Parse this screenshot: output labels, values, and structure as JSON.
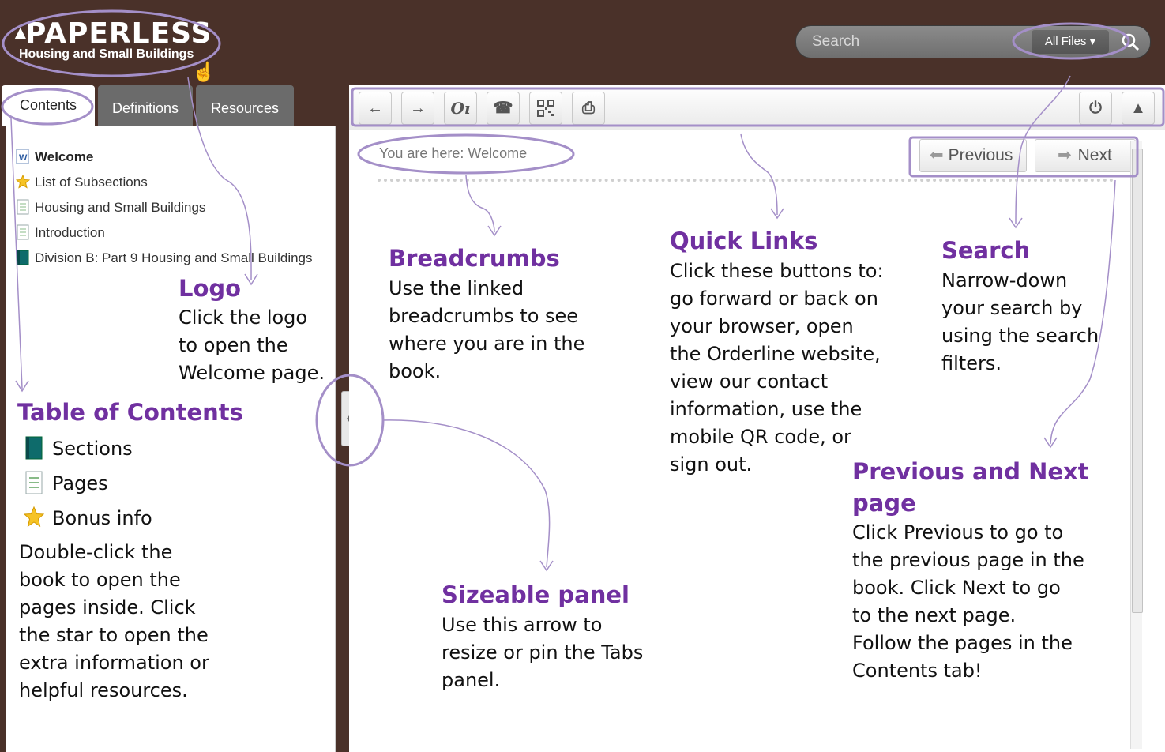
{
  "header": {
    "logo_text": "PAPERLESS",
    "logo_subtitle": "Housing and Small Buildings",
    "search_placeholder": "Search",
    "filter_label": "All Files ▾"
  },
  "tabs": [
    {
      "label": "Contents",
      "active": true
    },
    {
      "label": "Definitions",
      "active": false
    },
    {
      "label": "Resources",
      "active": false
    }
  ],
  "toc": [
    {
      "label": "Welcome",
      "icon": "word-doc-icon"
    },
    {
      "label": "List of Subsections",
      "icon": "star-icon"
    },
    {
      "label": "Housing and Small Buildings",
      "icon": "page-icon"
    },
    {
      "label": "Introduction",
      "icon": "page-icon"
    },
    {
      "label": "Division B: Part 9 Housing and Small Buildings",
      "icon": "book-icon"
    }
  ],
  "toolbar": {
    "buttons": [
      "back-arrow-icon",
      "forward-arrow-icon",
      "orderline-icon",
      "phone-icon",
      "qr-code-icon",
      "print-icon",
      "power-icon",
      "tree-icon"
    ]
  },
  "content": {
    "breadcrumb": "You are here: Welcome",
    "prev_label": "Previous",
    "next_label": "Next"
  },
  "annotations": {
    "logo": {
      "title": "Logo",
      "lines": [
        "Click the logo",
        "to open the",
        "Welcome page."
      ]
    },
    "toc": {
      "title": "Table of Contents",
      "legend": [
        {
          "label": "Sections",
          "icon": "book-icon"
        },
        {
          "label": "Pages",
          "icon": "page-icon"
        },
        {
          "label": "Bonus info",
          "icon": "star-icon"
        }
      ],
      "lines": [
        "Double-click the",
        "book to open the",
        "pages inside. Click",
        "the star to open the",
        "extra information or",
        "helpful resources."
      ]
    },
    "breadcrumbs": {
      "title": "Breadcrumbs",
      "lines": [
        "Use the linked",
        "breadcrumbs to see",
        "where you are in the",
        "book."
      ]
    },
    "quick_links": {
      "title": "Quick Links",
      "lines": [
        "Click these buttons to:",
        "go forward or back on",
        "your browser, open",
        "the Orderline website,",
        "view our contact",
        "information, use the",
        "mobile QR code, or",
        "sign out."
      ]
    },
    "search": {
      "title": "Search",
      "lines": [
        "Narrow-down",
        "your search by",
        "using the search",
        "filters."
      ]
    },
    "prev_next": {
      "title_lines": [
        "Previous and Next",
        "page"
      ],
      "lines": [
        "Click Previous to go to",
        "the previous page in the",
        "book. Click Next to go",
        "to the next page.",
        "Follow the pages in the",
        "Contents tab!"
      ]
    },
    "sizeable": {
      "title": "Sizeable panel",
      "lines": [
        "Use this arrow to",
        "resize or pin the Tabs",
        "panel."
      ]
    }
  },
  "colors": {
    "header_bg": "#4a3129",
    "annotation_title": "#7030a0",
    "callout_stroke": "#a48fc8"
  }
}
